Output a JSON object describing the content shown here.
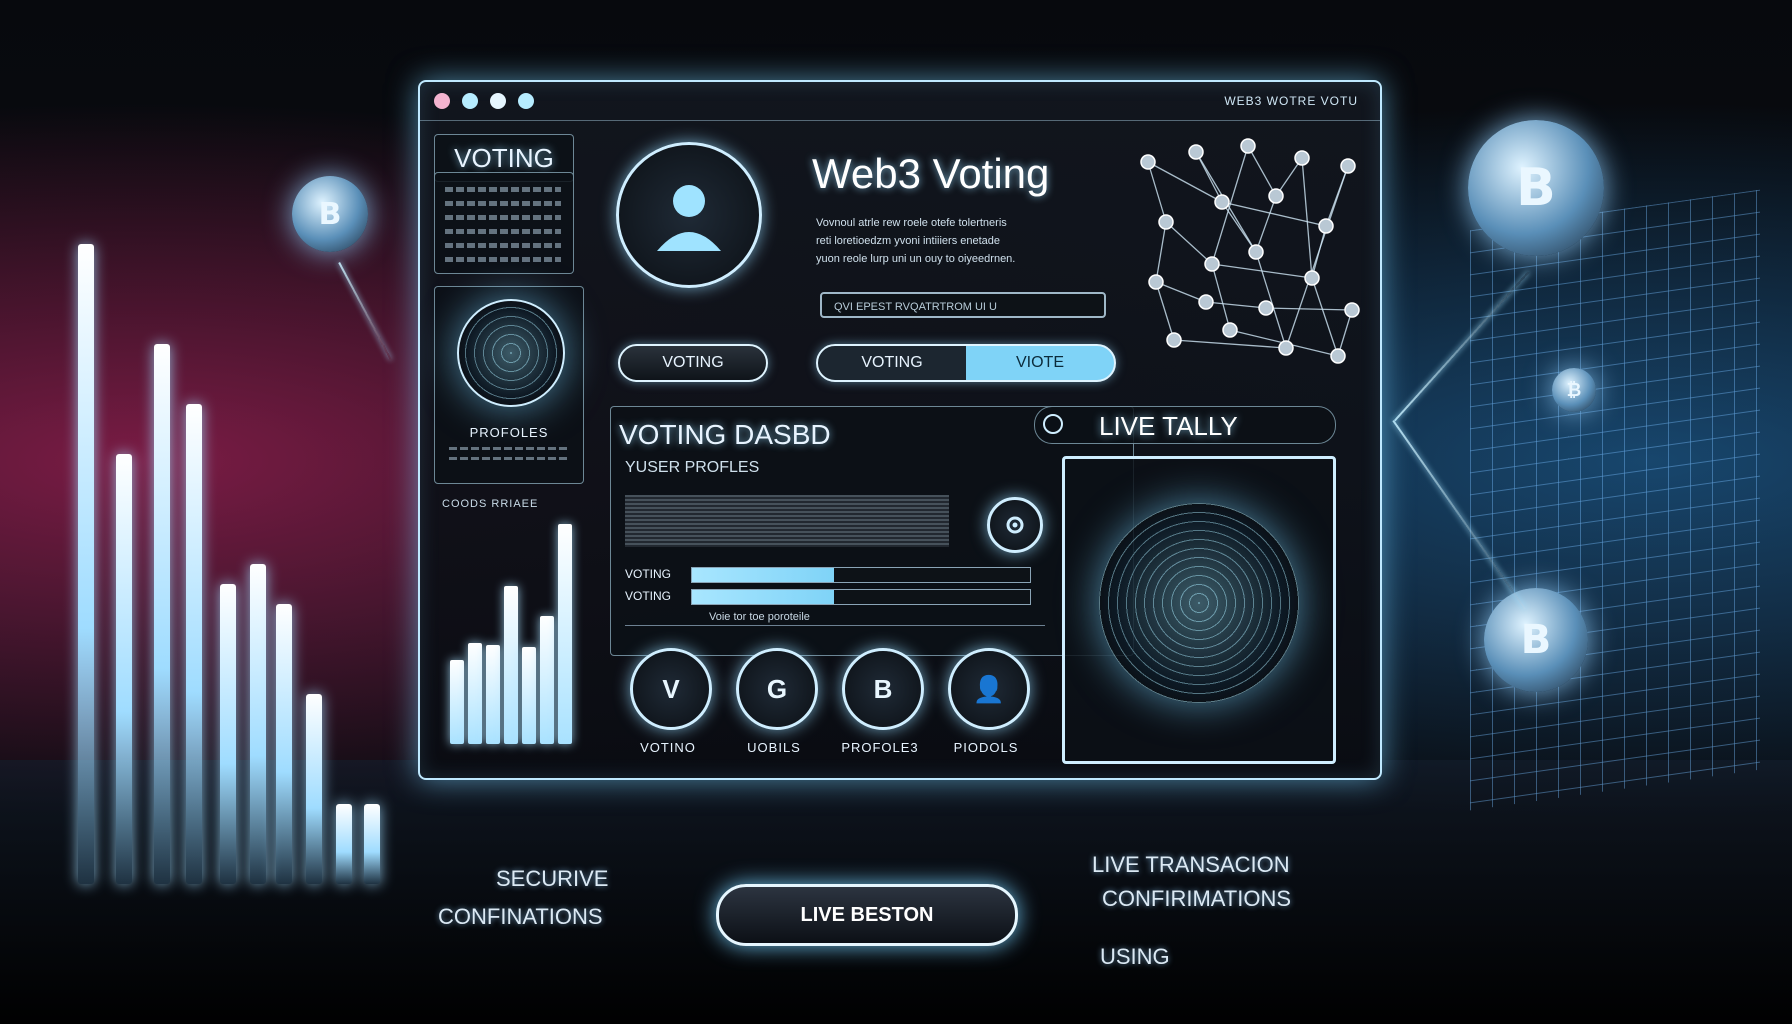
{
  "window": {
    "title": "WEB3 WOTRE VOTU",
    "dots": [
      "#f0a8c8",
      "#a8e6ff",
      "#d8f2ff",
      "#a8e6ff"
    ]
  },
  "sidebar": {
    "title": "VOTING",
    "profile_label": "PROFOLES",
    "chart_caption": "COODS RRIAEE"
  },
  "hero": {
    "title": "Web3 Voting",
    "description_lines": [
      "Vovnoul atrle rew roele otefe tolertneris",
      "reti loretioedzm yvoni intiiiers enetade",
      "yuon reole lurp uni un ouy to oiyeedrnen."
    ],
    "input_text": "QVI EPEST RVQATRTROM UI U",
    "button_voting": "VOTING",
    "toggle_left": "VOTING",
    "toggle_right": "VIOTE"
  },
  "dashboard": {
    "title": "VOTING DASBD",
    "subtitle": "YUSER PROFLES",
    "rows": [
      {
        "label": "VOTING",
        "fill": 0.42
      },
      {
        "label": "VOTING",
        "fill": 0.42
      }
    ],
    "note": "Voie tor toe poroteile",
    "icons": [
      {
        "label": "VOTINO",
        "glyph": "V"
      },
      {
        "label": "UOBILS",
        "glyph": "G"
      },
      {
        "label": "PROFOLE3",
        "glyph": "B"
      },
      {
        "label": "PIODOLS",
        "glyph": "👤"
      }
    ]
  },
  "tally": {
    "title": "LIVE TALLY"
  },
  "bottom": {
    "left_line1": "SECURIVE",
    "left_line2": "CONFINATIONS",
    "center_button": "LIVE BESTON",
    "right_line1": "LIVE TRANSACION",
    "right_line2": "CONFIRIMATIONS",
    "right_line3": "USING"
  },
  "coins": [
    "B",
    "B",
    "B"
  ],
  "sidebar_bars": [
    0.38,
    0.46,
    0.45,
    0.72,
    0.44,
    0.58,
    1.0
  ]
}
